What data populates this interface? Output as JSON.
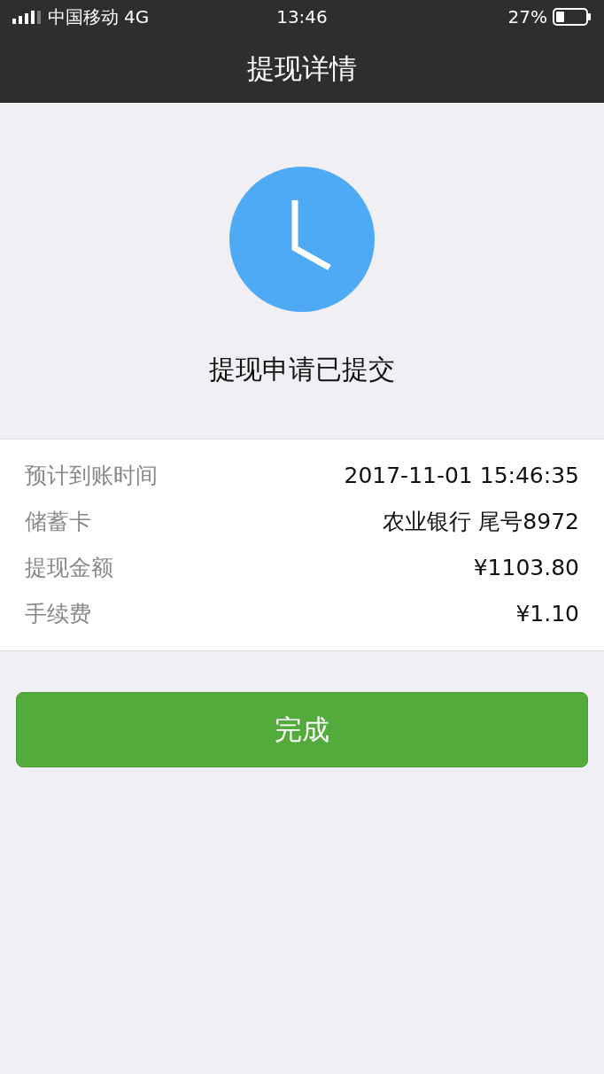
{
  "status_bar": {
    "carrier": "中国移动",
    "network": "4G",
    "time": "13:46",
    "battery": "27%"
  },
  "nav": {
    "title": "提现详情"
  },
  "result": {
    "message": "提现申请已提交"
  },
  "details": [
    {
      "label": "预计到账时间",
      "value": "2017-11-01 15:46:35"
    },
    {
      "label": "储蓄卡",
      "value": "农业银行 尾号8972"
    },
    {
      "label": "提现金额",
      "value": "¥1103.80"
    },
    {
      "label": "手续费",
      "value": "¥1.10"
    }
  ],
  "button": "完成"
}
